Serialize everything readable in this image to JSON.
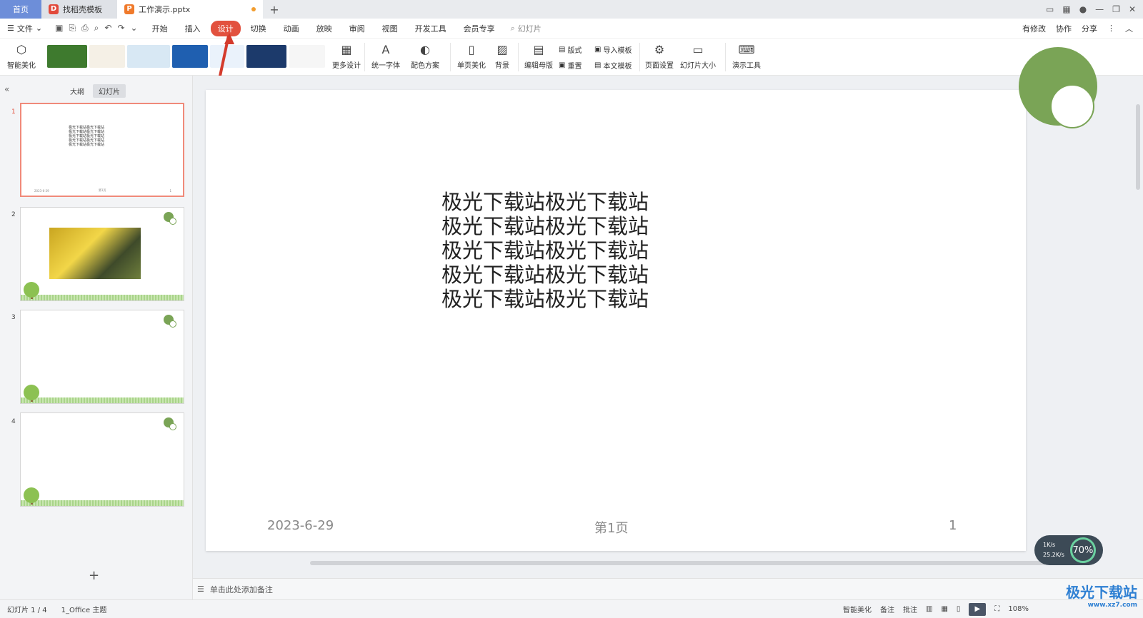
{
  "titlebar": {
    "tabs": [
      {
        "label": "首页"
      },
      {
        "label": "找稻壳模板",
        "icon": "docer-icon"
      },
      {
        "label": "工作演示.pptx",
        "icon": "ppt-icon"
      }
    ]
  },
  "menubar": {
    "file_label": "文件",
    "items": [
      "开始",
      "插入",
      "设计",
      "切换",
      "动画",
      "放映",
      "审阅",
      "视图",
      "开发工具",
      "会员专享"
    ],
    "active_item": "设计",
    "search_label": "幻灯片",
    "right": [
      "有修改",
      "协作",
      "分享"
    ]
  },
  "ribbon": {
    "smart_beautify": "智能美化",
    "more_design": "更多设计",
    "unify_font": "统一字体",
    "color_scheme": "配色方案",
    "single_page_beautify": "单页美化",
    "background": "背景",
    "edit_master": "编辑母版",
    "layout": "版式",
    "reset": "重置",
    "import_template": "导入模板",
    "text_template": "本文模板",
    "page_setup": "页面设置",
    "slide_size": "幻灯片大小",
    "presentation_tools": "演示工具"
  },
  "sidebar": {
    "tab_outline": "大纲",
    "tab_slides": "幻灯片",
    "slide_numbers": [
      "1",
      "2",
      "3",
      "4"
    ],
    "thumb1_text": "极光下载站极光下载站\n极光下载站极光下载站\n极光下载站极光下载站\n极光下载站极光下载站\n极光下载站极光下载站"
  },
  "slide": {
    "body": "极光下载站极光下载站\n极光下载站极光下载站\n极光下载站极光下载站\n极光下载站极光下载站\n极光下载站极光下载站",
    "date": "2023-6-29",
    "page": "第1页",
    "number": "1"
  },
  "net_widget": {
    "up": "1K/s",
    "down": "25.2K/s",
    "percent": "70%"
  },
  "notes": {
    "placeholder": "单击此处添加备注"
  },
  "statusbar": {
    "slide_count": "幻灯片 1 / 4",
    "theme": "1_Office 主题",
    "smart_beautify": "智能美化",
    "notes": "备注",
    "comments": "批注",
    "zoom": "108%"
  },
  "watermark": {
    "brand": "极光下载站",
    "url": "www.xz7.com"
  },
  "colors": {
    "accent": "#e2513e",
    "theme_green": "#7aa456",
    "home_tab": "#6d8ed9"
  }
}
